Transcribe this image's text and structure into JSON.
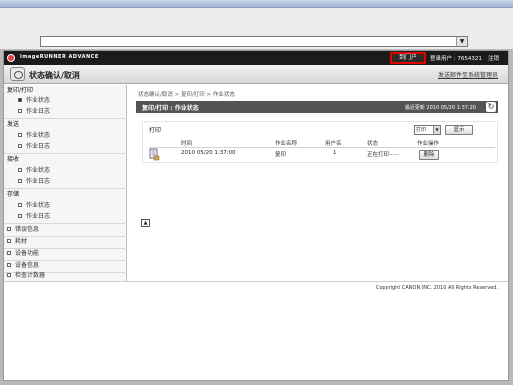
{
  "browser": {
    "address": ""
  },
  "header": {
    "brand": "imageRUNNER ADVANCE",
    "portal_button": "到门户",
    "user_info": "登录用户 : 7654321",
    "logout": "注销",
    "page_title": "状态确认/取消",
    "mail_link": "发送邮件至系统管理员"
  },
  "sidebar": {
    "copy_print": "复印/打印",
    "copy_job_status": "作业状态",
    "copy_job_log": "作业日志",
    "send": "发送",
    "send_job_status": "作业状态",
    "send_job_log": "作业日志",
    "receive": "接收",
    "receive_job_status": "作业状态",
    "receive_job_log": "作业日志",
    "store": "存储",
    "store_job_status": "作业状态",
    "store_job_log": "作业日志",
    "error_info": "错误信息",
    "consumables": "耗材",
    "device_functions": "设备功能",
    "device_info": "设备信息",
    "counter_check": "检查计数器"
  },
  "main": {
    "breadcrumb": "状态确认/取消 > 复印/打印 > 作业状态",
    "section_title": "复印/打印 : 作业状态",
    "last_updated": "最近更新  2010 05/20 1:37:20",
    "print_label": "打印",
    "filter_value": "打印",
    "display_button": "显示",
    "columns": [
      "时间",
      "作业名称",
      "用户名",
      "状态",
      "作业操作"
    ],
    "row": {
      "time": "2010 05/20 1:37:00",
      "job_name": "复印",
      "user": "1",
      "status": "正在打印······",
      "delete": "删除"
    }
  },
  "footer": {
    "copyright": "Copyright CANON INC. 2010 All Rights Reserved."
  }
}
